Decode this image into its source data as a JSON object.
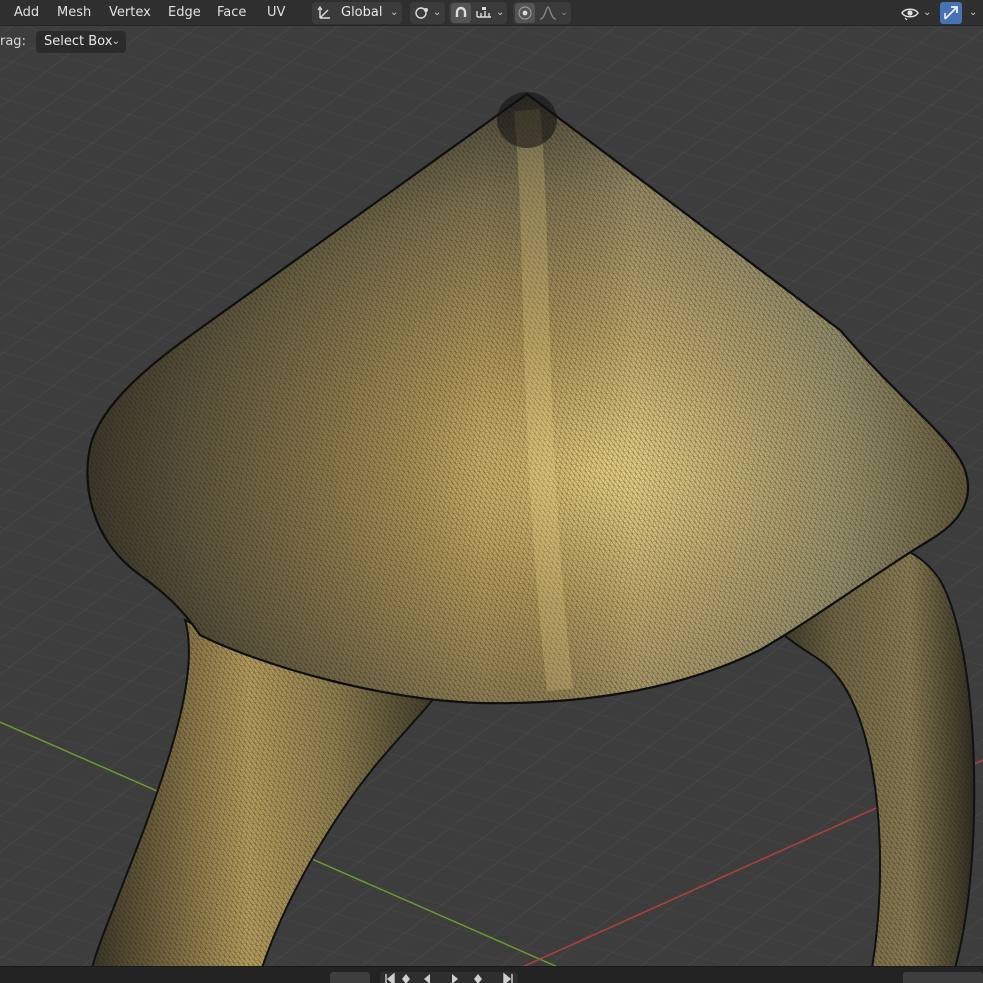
{
  "header": {
    "menus": [
      "Add",
      "Mesh",
      "Vertex",
      "Edge",
      "Face",
      "UV"
    ],
    "orientation_label": "Global",
    "icons": {
      "orientation": "transform-orientation-icon",
      "pivot": "pivot-point-icon",
      "snap": "snap-magnet-icon",
      "snap_target": "snap-increment-icon",
      "proportional": "proportional-editing-icon",
      "falloff": "falloff-curve-icon",
      "visibility": "visibility-eye-icon",
      "gizmo": "gizmo-toggle-icon"
    },
    "accent_color": "#4772b3"
  },
  "tool_settings": {
    "drag_label": "rag:",
    "drag_mode": "Select Box"
  },
  "viewport": {
    "background_color": "#3d3d3d",
    "grid_color": "#4a4a4a",
    "x_axis_color": "#b3403f",
    "y_axis_color": "#6c9b2f",
    "mesh_base_color": "#a89356",
    "mesh_wire_color": "#1c1a12"
  },
  "timeline": {
    "frame_value": "",
    "icons": [
      "jump-start-icon",
      "keyframe-prev-icon",
      "play-reverse-icon",
      "play-icon",
      "keyframe-next-icon",
      "jump-end-icon"
    ]
  }
}
